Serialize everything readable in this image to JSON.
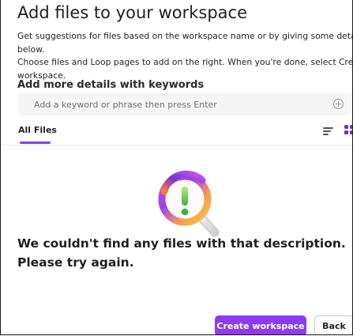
{
  "dialog": {
    "title": "Add files to your workspace",
    "description_line1": "Get suggestions for files based on the workspace name or by giving some details",
    "description_line2": "below.",
    "description_line3": "Choose files and Loop pages to add on the right. When you're done, select Create",
    "description_line4": "workspace."
  },
  "keywords": {
    "label": "Add more details with keywords",
    "placeholder": "Add a keyword or phrase then press Enter",
    "add_icon": "add-circle-icon"
  },
  "tabs": {
    "active": "All Files",
    "view_icons": [
      "list-view-icon",
      "grid-view-icon"
    ]
  },
  "empty_state": {
    "icon": "search-magnifier-illustration",
    "message": "We couldn't find any files with that description. Please try again."
  },
  "footer": {
    "primary_label": "Create workspace",
    "secondary_label": "Back"
  },
  "colors": {
    "accent": "#8b3cf0",
    "tab_underline": "#8a3ff0",
    "input_background": "#f5f5f5"
  }
}
